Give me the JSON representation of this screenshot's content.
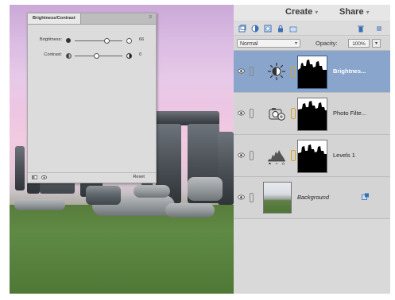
{
  "topbar": {
    "create_label": "Create",
    "share_label": "Share",
    "chevron": "▾"
  },
  "layers_panel": {
    "blend_mode": "Normal",
    "opacity_label": "Opacity:",
    "opacity_value": "100%",
    "layers": [
      {
        "name": "Brightnes...",
        "selected": true,
        "icon": "brightness-icon"
      },
      {
        "name": "Photo Filte...",
        "selected": false,
        "icon": "photo-filter-icon"
      },
      {
        "name": "Levels 1",
        "selected": false,
        "icon": "levels-icon"
      },
      {
        "name": "Background",
        "selected": false,
        "icon": "image-thumbnail"
      }
    ]
  },
  "bc_panel": {
    "tab_label": "Brightness/Contrast",
    "menu_glyph": "≡",
    "brightness_label": "Brightness:",
    "brightness_value": "66",
    "contrast_label": "Contrast:",
    "contrast_value": "0",
    "reset_label": "Reset"
  },
  "colors": {
    "selected_layer": "#8aa5cc",
    "panel_bg": "#d9d9d9",
    "chain_link": "#d9a22a"
  }
}
